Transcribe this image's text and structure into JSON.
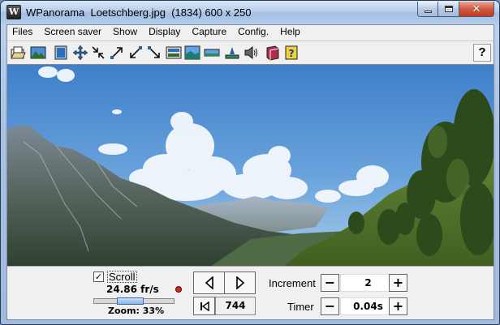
{
  "window": {
    "title": "WPanorama  Loetschberg.jpg  (1834) 600 x 250",
    "icon_letter": "W"
  },
  "menu": [
    "Files",
    "Screen saver",
    "Show",
    "Display",
    "Capture",
    "Config.",
    "Help"
  ],
  "toolbar": {
    "buttons": [
      "open-file-icon",
      "image-icon",
      "fit-window-icon",
      "move-icon",
      "shrink-icon",
      "expand-up-icon",
      "expand-down-icon",
      "shrink-down-icon",
      "panel-icon",
      "landscape-icon",
      "strip-icon",
      "level-icon",
      "speaker-icon",
      "book-icon",
      "help-book-icon"
    ],
    "help_label": "?"
  },
  "controls": {
    "scroll_checked": "✓",
    "scroll_label": "Scroll",
    "fps": "24.86 fr/s",
    "zoom_label": "Zoom: 33%",
    "zoom_fraction": 0.33,
    "position": "744",
    "increment_label": "Increment",
    "increment_value": "2",
    "timer_label": "Timer",
    "timer_value": "0.04s",
    "minus": "−",
    "plus": "+"
  },
  "colors": {
    "sky_top": "#3f7fc9",
    "sky_bottom": "#a9cbe9",
    "accent": "#3d6fb3"
  }
}
